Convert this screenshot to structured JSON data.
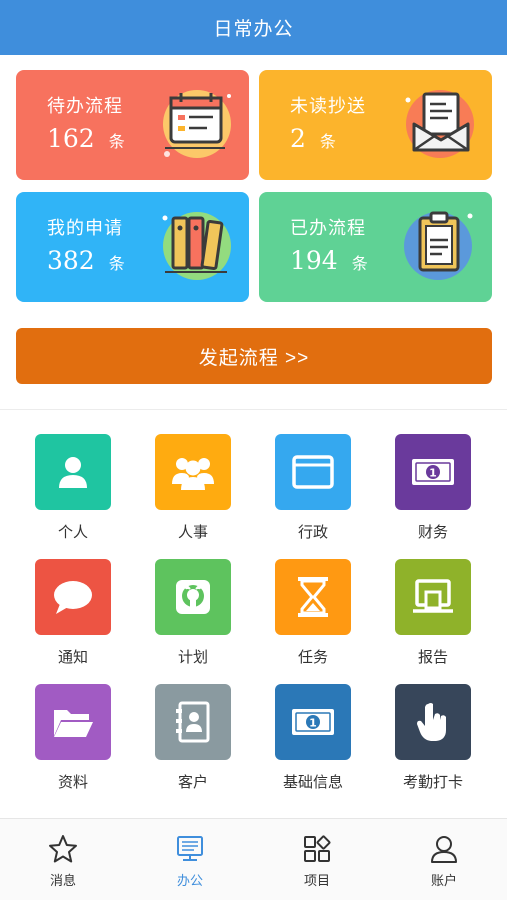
{
  "header": {
    "title": "日常办公"
  },
  "cards": [
    {
      "name": "待办流程",
      "count": "162",
      "unit": "条",
      "color": "#f7725e",
      "icon": "calendar-icon"
    },
    {
      "name": "未读抄送",
      "count": "2",
      "unit": "条",
      "color": "#fcb42c",
      "icon": "envelope-icon"
    },
    {
      "name": "我的申请",
      "count": "382",
      "unit": "条",
      "color": "#30b4f7",
      "icon": "binders-icon"
    },
    {
      "name": "已办流程",
      "count": "194",
      "unit": "条",
      "color": "#5fd295",
      "icon": "clipboard-icon"
    }
  ],
  "start_button": {
    "label": "发起流程 >>",
    "color": "#e16e0f"
  },
  "grid": [
    {
      "label": "个人",
      "color": "#1fc5a1",
      "icon": "person-icon"
    },
    {
      "label": "人事",
      "color": "#ffab10",
      "icon": "group-icon"
    },
    {
      "label": "行政",
      "color": "#35a8ef",
      "icon": "window-icon"
    },
    {
      "label": "财务",
      "color": "#6a3a9c",
      "icon": "money-icon"
    },
    {
      "label": "通知",
      "color": "#ed5443",
      "icon": "chat-bubble-icon"
    },
    {
      "label": "计划",
      "color": "#5ec35e",
      "icon": "github-icon"
    },
    {
      "label": "任务",
      "color": "#ff9912",
      "icon": "hourglass-icon"
    },
    {
      "label": "报告",
      "color": "#8fb22a",
      "icon": "monitor-icon"
    },
    {
      "label": "资料",
      "color": "#a15bc3",
      "icon": "folder-icon"
    },
    {
      "label": "客户",
      "color": "#8a9aa0",
      "icon": "contacts-icon"
    },
    {
      "label": "基础信息",
      "color": "#2b78b7",
      "icon": "money-icon"
    },
    {
      "label": "考勤打卡",
      "color": "#37465a",
      "icon": "pointer-hand-icon"
    }
  ],
  "tabs": [
    {
      "label": "消息",
      "icon": "star-icon",
      "active": false
    },
    {
      "label": "办公",
      "icon": "desktop-icon",
      "active": true
    },
    {
      "label": "项目",
      "icon": "apps-icon",
      "active": false
    },
    {
      "label": "账户",
      "icon": "user-icon",
      "active": false
    }
  ],
  "colors": {
    "header": "#3f8edc",
    "accent": "#3f8edc",
    "tab_text": "#333333"
  }
}
